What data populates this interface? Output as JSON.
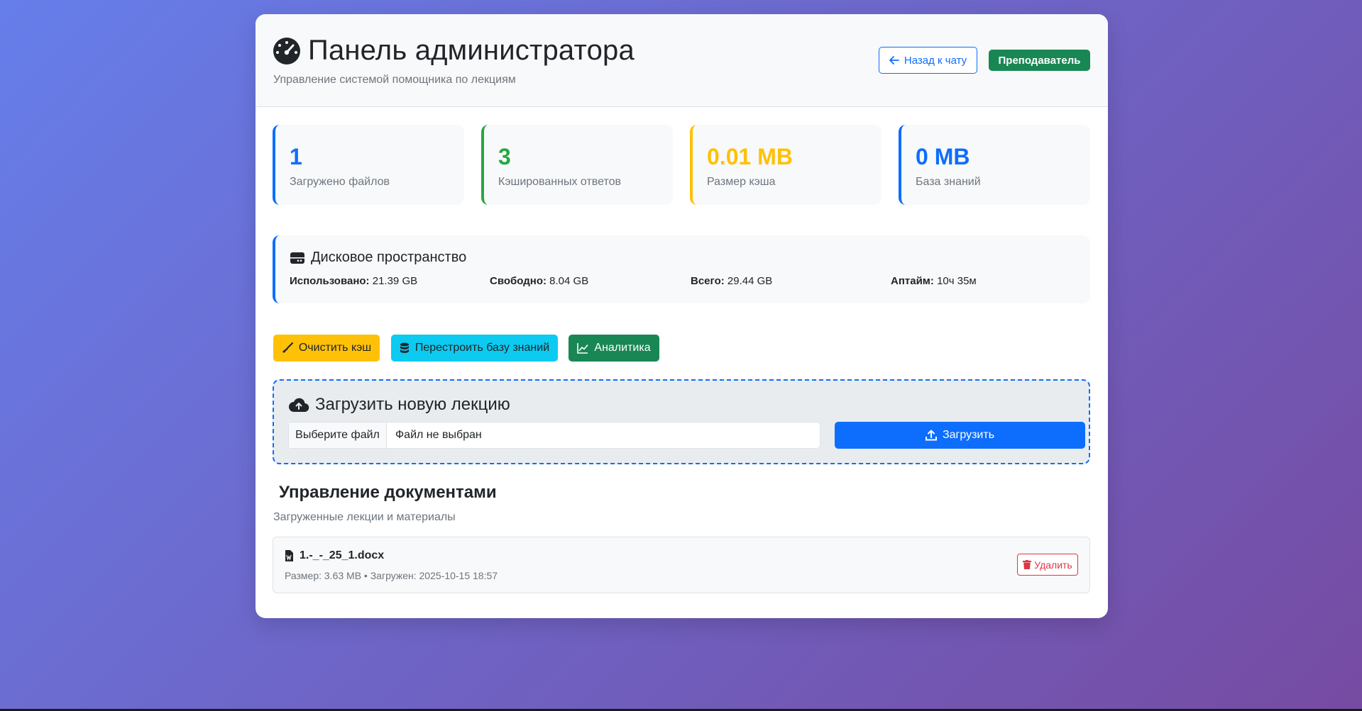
{
  "header": {
    "title": "Панель администратора",
    "subtitle": "Управление системой помощника по лекциям",
    "back_label": "Назад к чату",
    "role_badge": "Преподаватель"
  },
  "stats": [
    {
      "value": "1",
      "label": "Загружено файлов",
      "color": "#0d6efd"
    },
    {
      "value": "3",
      "label": "Кэшированных ответов",
      "color": "#28a745"
    },
    {
      "value": "0.01 MB",
      "label": "Размер кэша",
      "color": "#ffc107"
    },
    {
      "value": "0 MB",
      "label": "База знаний",
      "color": "#0d6efd"
    }
  ],
  "disk": {
    "title": "Дисковое пространство",
    "used_label": "Использовано:",
    "used_value": "21.39 GB",
    "free_label": "Свободно:",
    "free_value": "8.04 GB",
    "total_label": "Всего:",
    "total_value": "29.44 GB",
    "uptime_label": "Аптайм:",
    "uptime_value": "10ч 35м"
  },
  "actions": {
    "clear_cache": "Очистить кэш",
    "rebuild": "Перестроить базу знаний",
    "analytics": "Аналитика"
  },
  "upload": {
    "title": "Загрузить новую лекцию",
    "choose_file": "Выберите файл",
    "no_file": "Файл не выбран",
    "submit": "Загрузить"
  },
  "documents": {
    "title": "Управление документами",
    "subtitle": "Загруженные лекции и материалы",
    "items": [
      {
        "name": "1.-_-_25_1.docx",
        "meta": "Размер: 3.63 MB • Загружен: 2025-10-15 18:57",
        "delete_label": "Удалить"
      }
    ]
  },
  "colors": {
    "primary": "#0d6efd",
    "success": "#198754",
    "warning": "#ffc107",
    "info": "#0dcaf0",
    "danger": "#dc3545"
  },
  "icons": [
    "speedometer-icon",
    "arrow-left-icon",
    "hdd-icon",
    "broom-icon",
    "database-icon",
    "graph-up-icon",
    "cloud-upload-icon",
    "upload-icon",
    "file-word-icon",
    "trash-icon"
  ]
}
